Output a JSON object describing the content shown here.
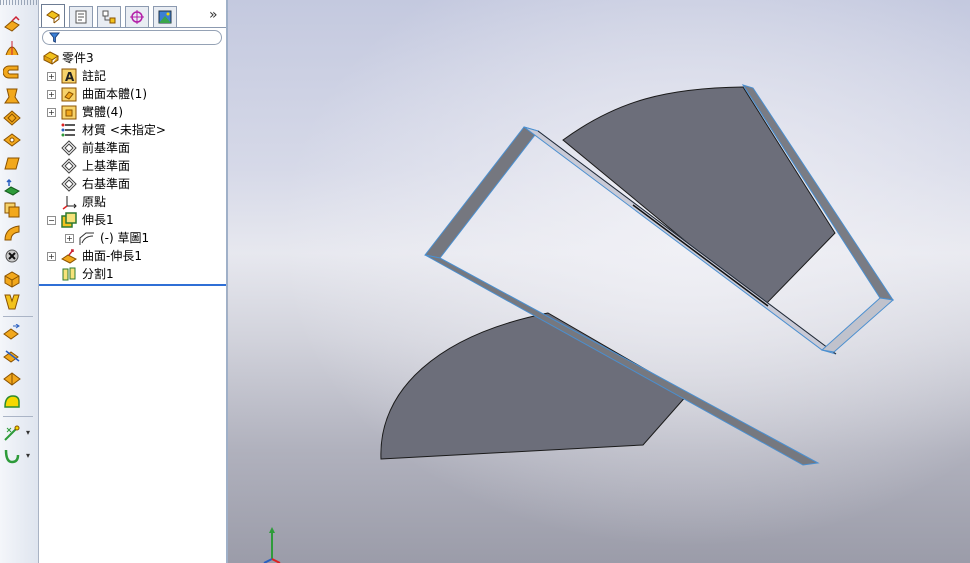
{
  "toolbar": {
    "tools": [
      {
        "name": "extruded-boss-icon"
      },
      {
        "name": "revolved-surface-icon"
      },
      {
        "name": "swept-surface-icon"
      },
      {
        "name": "lofted-surface-icon"
      },
      {
        "name": "boundary-surface-icon"
      },
      {
        "name": "planar-surface-icon"
      },
      {
        "name": "fill-surface-icon"
      },
      {
        "name": "offset-surface-icon"
      },
      {
        "name": "radiated-surface-icon"
      },
      {
        "name": "knit-surface-icon"
      },
      {
        "name": "ruled-surface-icon"
      },
      {
        "name": "delete-face-icon"
      },
      {
        "name": "replace-face-icon"
      },
      {
        "name": "extend-surface-icon"
      },
      {
        "name": "trim-surface-icon"
      },
      {
        "name": "untrim-surface-icon"
      },
      {
        "name": "thicken-icon"
      },
      {
        "name": "reference-geometry-icon"
      },
      {
        "name": "curves-icon"
      }
    ]
  },
  "panel": {
    "tabs": [
      {
        "name": "featuremanager-tab"
      },
      {
        "name": "propertymanager-tab"
      },
      {
        "name": "configurationmanager-tab"
      },
      {
        "name": "dimxpert-tab"
      },
      {
        "name": "display-manager-tab"
      }
    ],
    "more": "»"
  },
  "tree": {
    "root": "零件3",
    "items": [
      {
        "label": "註記",
        "expander": "+"
      },
      {
        "label": "曲面本體(1)",
        "expander": "+"
      },
      {
        "label": "實體(4)",
        "expander": "+"
      },
      {
        "label": "材質 <未指定>",
        "expander": ""
      },
      {
        "label": "前基準面",
        "expander": ""
      },
      {
        "label": "上基準面",
        "expander": ""
      },
      {
        "label": "右基準面",
        "expander": ""
      },
      {
        "label": "原點",
        "expander": ""
      },
      {
        "label": "伸長1",
        "expander": "−"
      },
      {
        "label": "(-) 草圖1",
        "expander": "+"
      },
      {
        "label": "曲面-伸長1",
        "expander": "+"
      },
      {
        "label": "分割1",
        "expander": ""
      }
    ]
  },
  "colors": {
    "surface": "#6c6e7a",
    "edge_highlight": "#4a8fd0",
    "selection": "#2f6fd6"
  }
}
